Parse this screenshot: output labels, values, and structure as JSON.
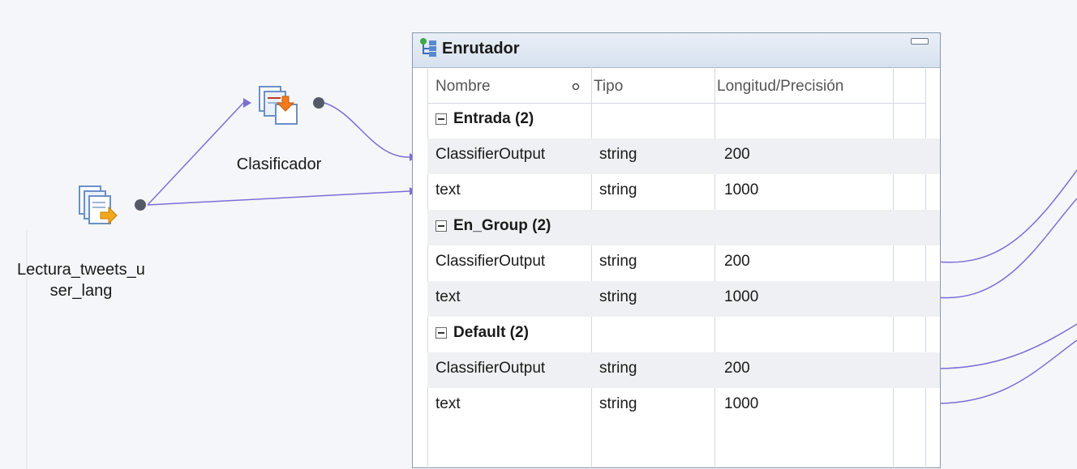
{
  "nodes": {
    "source": {
      "label_line1": "Lectura_tweets_u",
      "label_line2": "ser_lang",
      "icon": "source-qualifier-icon"
    },
    "classifier": {
      "label": "Clasificador",
      "icon": "classifier-icon"
    }
  },
  "router": {
    "title": "Enrutador",
    "icon": "router-icon",
    "columns": {
      "name": "Nombre",
      "type": "Tipo",
      "length": "Longitud/Precisión"
    },
    "groups": [
      {
        "label": "Entrada (2)",
        "ports": [
          {
            "name": "ClassifierOutput",
            "type": "string",
            "length": "200"
          },
          {
            "name": "text",
            "type": "string",
            "length": "1000"
          }
        ]
      },
      {
        "label": "En_Group (2)",
        "ports": [
          {
            "name": "ClassifierOutput",
            "type": "string",
            "length": "200"
          },
          {
            "name": "text",
            "type": "string",
            "length": "1000"
          }
        ]
      },
      {
        "label": "Default (2)",
        "ports": [
          {
            "name": "ClassifierOutput",
            "type": "string",
            "length": "200"
          },
          {
            "name": "text",
            "type": "string",
            "length": "1000"
          }
        ]
      }
    ]
  },
  "colors": {
    "link": "#7b6fd6",
    "header": "#dbe4f0",
    "border": "#8a99ad"
  }
}
